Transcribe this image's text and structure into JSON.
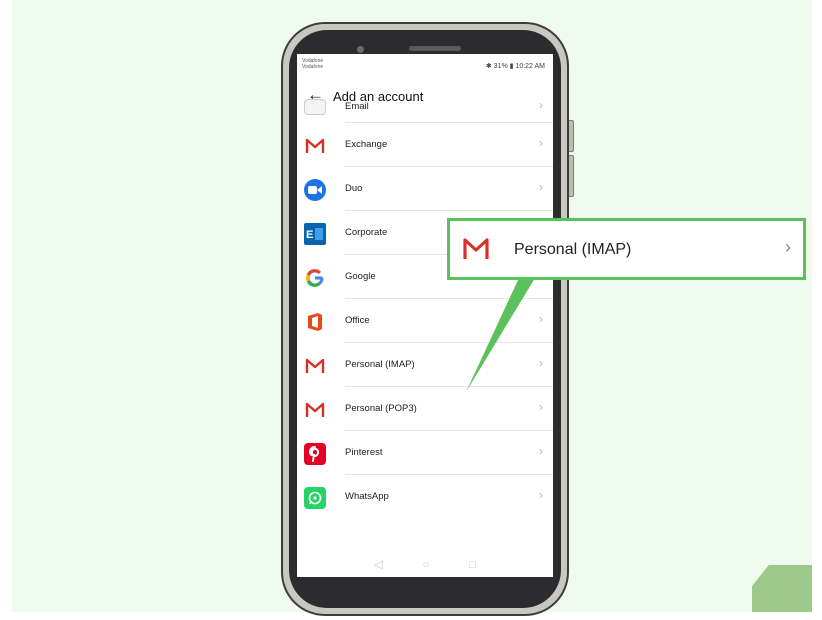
{
  "status_bar": {
    "carrier_line1": "Vodafone",
    "carrier_line2": "Vodafone",
    "right_text": "✱ 31% ▮ 10:22 AM"
  },
  "app_bar": {
    "back_glyph": "←",
    "title": "Add an account"
  },
  "accounts": [
    {
      "label": "Email",
      "icon": "email-icon"
    },
    {
      "label": "Exchange",
      "icon": "gmail-m-icon"
    },
    {
      "label": "Duo",
      "icon": "duo-icon"
    },
    {
      "label": "Corporate",
      "icon": "exchange-icon"
    },
    {
      "label": "Google",
      "icon": "google-icon"
    },
    {
      "label": "Office",
      "icon": "office-icon"
    },
    {
      "label": "Personal (IMAP)",
      "icon": "gmail-m-icon"
    },
    {
      "label": "Personal (POP3)",
      "icon": "gmail-m-icon"
    },
    {
      "label": "Pinterest",
      "icon": "pinterest-icon"
    },
    {
      "label": "WhatsApp",
      "icon": "whatsapp-icon"
    }
  ],
  "chevron": "›",
  "nav": {
    "back": "◁",
    "home": "○",
    "recents": "□"
  },
  "callout": {
    "label": "Personal (IMAP)",
    "icon": "gmail-m-icon",
    "highlight_color": "#5bc15b"
  },
  "colors": {
    "background": "#effbef",
    "accent_green": "#5bc15b",
    "gmail_red": "#d93025"
  }
}
